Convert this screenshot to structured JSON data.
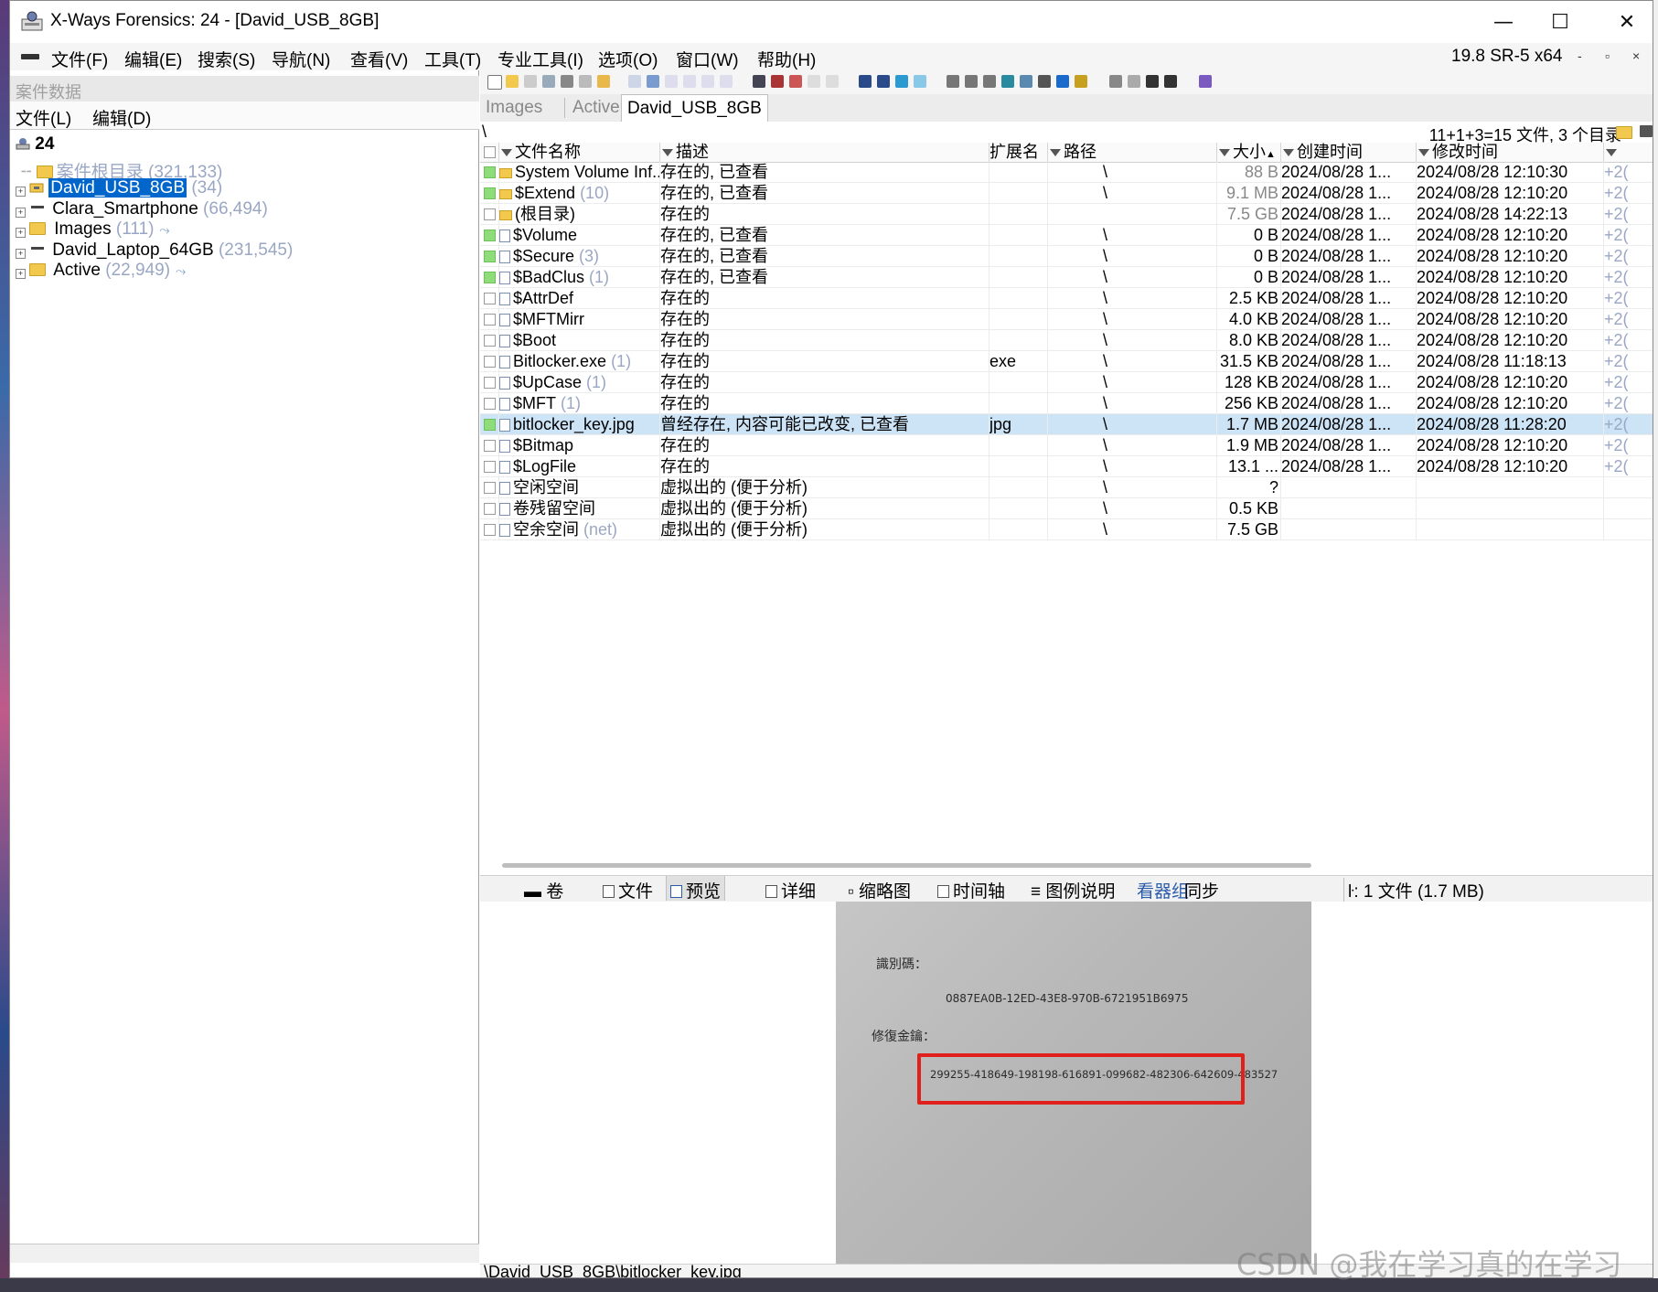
{
  "window": {
    "title": "X-Ways Forensics: 24 - [David_USB_8GB]",
    "controls": {
      "minimize": "—",
      "maximize": "☐",
      "close": "✕"
    }
  },
  "menubar": {
    "items": [
      "文件(F)",
      "编辑(E)",
      "搜索(S)",
      "导航(N)",
      "查看(V)",
      "工具(T)",
      "专业工具(I)",
      "选项(O)",
      "窗口(W)",
      "帮助(H)"
    ],
    "version": "19.8 SR-5 x64",
    "mdi_controls": [
      "-",
      "▫",
      "×"
    ]
  },
  "left_pane": {
    "header": "案件数据",
    "menu": [
      "文件(L)",
      "编辑(D)"
    ],
    "root": {
      "label": "24"
    },
    "tree": [
      {
        "label": "案件根目录",
        "count": "(321,133)"
      },
      {
        "label": "David_USB_8GB",
        "count": "(34)"
      },
      {
        "label": "Clara_Smartphone",
        "count": "(66,494)"
      },
      {
        "label": "Images",
        "count": "(111)"
      },
      {
        "label": "David_Laptop_64GB",
        "count": "(231,545)"
      },
      {
        "label": "Active",
        "count": "(22,949)"
      }
    ]
  },
  "right_pane": {
    "tabs": [
      "Images",
      "Active",
      "David_USB_8GB"
    ],
    "path": "\\",
    "summary": "11+1+3=15 文件, 3 个目录",
    "columns": [
      "文件名称",
      "描述",
      "扩展名",
      "路径",
      "大小",
      "创建时间",
      "修改时间"
    ],
    "rows": [
      {
        "name": "System Volume Inf...",
        "count": "",
        "desc": "存在的, 已查看",
        "ext": "",
        "path": "\\",
        "size": "88 B",
        "created": "2024/08/28  1...",
        "modified": "2024/08/28  12:10:30",
        "extra": "+2(",
        "checked": true,
        "folder": true,
        "size_gray": true
      },
      {
        "name": "$Extend",
        "count": "(10)",
        "desc": "存在的, 已查看",
        "ext": "",
        "path": "\\",
        "size": "9.1 MB",
        "created": "2024/08/28  1...",
        "modified": "2024/08/28  12:10:20",
        "extra": "+2(",
        "checked": true,
        "folder": true,
        "size_gray": true
      },
      {
        "name": "(根目录)",
        "count": "",
        "desc": "存在的",
        "ext": "",
        "path": "",
        "size": "7.5 GB",
        "created": "2024/08/28  1...",
        "modified": "2024/08/28  14:22:13",
        "extra": "+2(",
        "checked": false,
        "folder": true,
        "size_gray": true
      },
      {
        "name": "$Volume",
        "count": "",
        "desc": "存在的, 已查看",
        "ext": "",
        "path": "\\",
        "size": "0 B",
        "created": "2024/08/28  1...",
        "modified": "2024/08/28  12:10:20",
        "extra": "+2(",
        "checked": true,
        "folder": false,
        "size_gray": false
      },
      {
        "name": "$Secure",
        "count": "(3)",
        "desc": "存在的, 已查看",
        "ext": "",
        "path": "\\",
        "size": "0 B",
        "created": "2024/08/28  1...",
        "modified": "2024/08/28  12:10:20",
        "extra": "+2(",
        "checked": true,
        "folder": false,
        "size_gray": false
      },
      {
        "name": "$BadClus",
        "count": "(1)",
        "desc": "存在的, 已查看",
        "ext": "",
        "path": "\\",
        "size": "0 B",
        "created": "2024/08/28  1...",
        "modified": "2024/08/28  12:10:20",
        "extra": "+2(",
        "checked": true,
        "folder": false,
        "size_gray": false
      },
      {
        "name": "$AttrDef",
        "count": "",
        "desc": "存在的",
        "ext": "",
        "path": "\\",
        "size": "2.5 KB",
        "created": "2024/08/28  1...",
        "modified": "2024/08/28  12:10:20",
        "extra": "+2(",
        "checked": false,
        "folder": false,
        "size_gray": false
      },
      {
        "name": "$MFTMirr",
        "count": "",
        "desc": "存在的",
        "ext": "",
        "path": "\\",
        "size": "4.0 KB",
        "created": "2024/08/28  1...",
        "modified": "2024/08/28  12:10:20",
        "extra": "+2(",
        "checked": false,
        "folder": false,
        "size_gray": false
      },
      {
        "name": "$Boot",
        "count": "",
        "desc": "存在的",
        "ext": "",
        "path": "\\",
        "size": "8.0 KB",
        "created": "2024/08/28  1...",
        "modified": "2024/08/28  12:10:20",
        "extra": "+2(",
        "checked": false,
        "folder": false,
        "size_gray": false
      },
      {
        "name": "Bitlocker.exe",
        "count": "(1)",
        "desc": "存在的",
        "ext": "exe",
        "path": "\\",
        "size": "31.5 KB",
        "created": "2024/08/28  1...",
        "modified": "2024/08/28  11:18:13",
        "extra": "+2(",
        "checked": false,
        "folder": false,
        "size_gray": false
      },
      {
        "name": "$UpCase",
        "count": "(1)",
        "desc": "存在的",
        "ext": "",
        "path": "\\",
        "size": "128 KB",
        "created": "2024/08/28  1...",
        "modified": "2024/08/28  12:10:20",
        "extra": "+2(",
        "checked": false,
        "folder": false,
        "size_gray": false
      },
      {
        "name": "$MFT",
        "count": "(1)",
        "desc": "存在的",
        "ext": "",
        "path": "\\",
        "size": "256 KB",
        "created": "2024/08/28  1...",
        "modified": "2024/08/28  12:10:20",
        "extra": "+2(",
        "checked": false,
        "folder": false,
        "size_gray": false
      },
      {
        "name": "bitlocker_key.jpg",
        "count": "",
        "desc": "曾经存在, 内容可能已改变, 已查看",
        "ext": "jpg",
        "path": "\\",
        "size": "1.7 MB",
        "created": "2024/08/28  1...",
        "modified": "2024/08/28  11:28:20",
        "extra": "+2(",
        "checked": true,
        "folder": false,
        "size_gray": false,
        "selected": true
      },
      {
        "name": "$Bitmap",
        "count": "",
        "desc": "存在的",
        "ext": "",
        "path": "\\",
        "size": "1.9 MB",
        "created": "2024/08/28  1...",
        "modified": "2024/08/28  12:10:20",
        "extra": "+2(",
        "checked": false,
        "folder": false,
        "size_gray": false
      },
      {
        "name": "$LogFile",
        "count": "",
        "desc": "存在的",
        "ext": "",
        "path": "\\",
        "size": "13.1 ...",
        "created": "2024/08/28  1...",
        "modified": "2024/08/28  12:10:20",
        "extra": "+2(",
        "checked": false,
        "folder": false,
        "size_gray": false
      },
      {
        "name": "空闲空间",
        "count": "",
        "desc": "虚拟出的 (便于分析)",
        "ext": "",
        "path": "\\",
        "size": "?",
        "created": "",
        "modified": "",
        "extra": "",
        "checked": false,
        "folder": false,
        "size_gray": false
      },
      {
        "name": "卷残留空间",
        "count": "",
        "desc": "虚拟出的 (便于分析)",
        "ext": "",
        "path": "\\",
        "size": "0.5 KB",
        "created": "",
        "modified": "",
        "extra": "",
        "checked": false,
        "folder": false,
        "size_gray": false
      },
      {
        "name": "空余空间",
        "count": "(net)",
        "desc": "虚拟出的 (便于分析)",
        "ext": "",
        "path": "\\",
        "size": "7.5 GB",
        "created": "",
        "modified": "",
        "extra": "",
        "checked": false,
        "folder": false,
        "size_gray": false
      }
    ],
    "bottom_tabs": [
      "卷",
      "文件",
      "预览",
      "详细",
      "缩略图",
      "时间轴",
      "图例说明",
      "看器组",
      "同步"
    ],
    "selection_status": "ŀ: 1 文件 (1.7 MB)",
    "preview": {
      "label_id": "識別碼：",
      "id_value": "0887EA0B-12ED-43E8-970B-6721951B6975",
      "label_key": "修復金鑰：",
      "key_value": "299255-418649-198198-616891-099682-482306-642609-483527"
    },
    "status_path": "\\David_USB_8GB\\bitlocker_key.jpg"
  },
  "watermark": "CSDN @我在学习真的在学习",
  "colors": {
    "selection": "#0066cc",
    "row_selected": "#cde4f7",
    "checked_green": "#8fdc7a",
    "highlight_box": "#e0201b",
    "count_gray": "#9aa7c4"
  }
}
